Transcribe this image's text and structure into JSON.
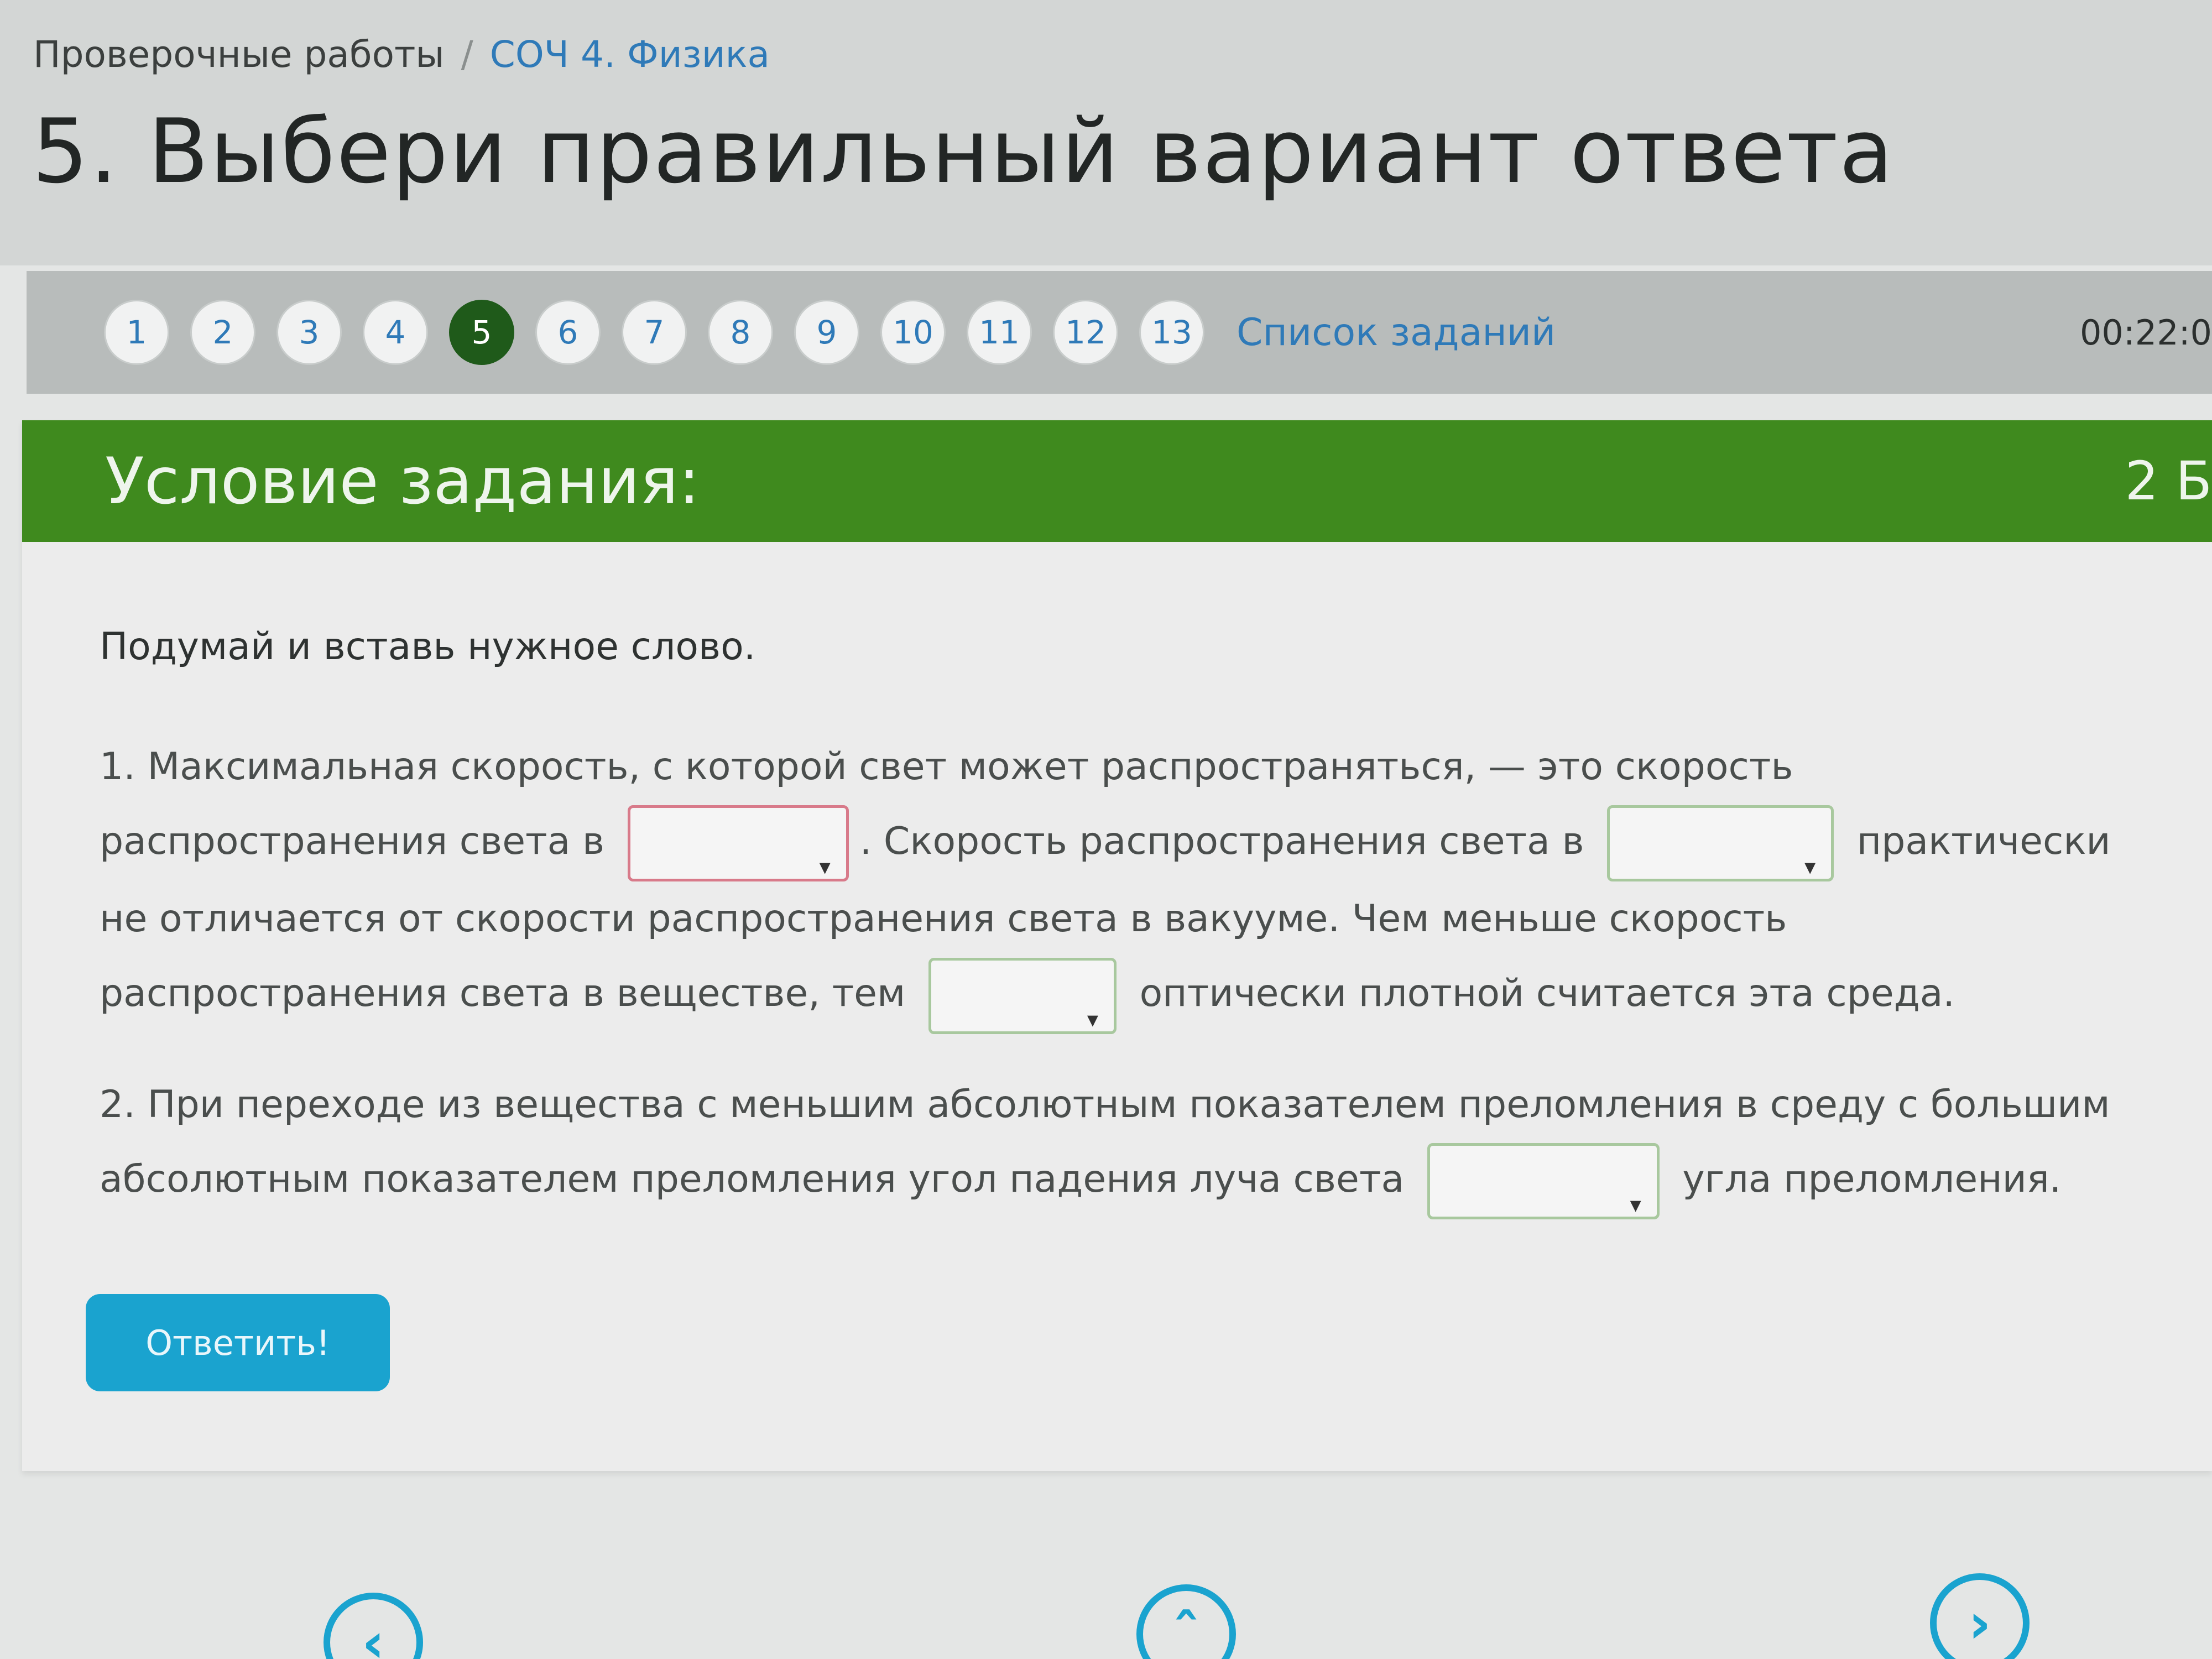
{
  "breadcrumb": {
    "root": "Проверочные работы",
    "separator": "/",
    "current": "СОЧ 4. Физика"
  },
  "page_title": "5. Выбери правильный вариант ответа",
  "pager": {
    "pages": [
      "1",
      "2",
      "3",
      "4",
      "5",
      "6",
      "7",
      "8",
      "9",
      "10",
      "11",
      "12",
      "13"
    ],
    "active": "5",
    "task_list_label": "Список заданий",
    "timer": "00:22:0"
  },
  "card": {
    "title": "Условие задания:",
    "points": "2 Б",
    "instruction": "Подумай и вставь нужное слово.",
    "q1": {
      "part1": "1. Максимальная скорость, с которой свет может распространяться, — это скорость распространения света в",
      "part2": ". Скорость распространения света в",
      "part3": "практически не отличается от скорости распространения света в вакууме. Чем меньше скорость распространения света в веществе, тем",
      "part4": "оптически плотной считается эта среда."
    },
    "q2": {
      "part1": "2.  При переходе из вещества с  меньшим абсолютным показателем преломления в среду с большим абсолютным показателем преломления угол падения луча света",
      "part2": "угла преломления."
    },
    "dropdown_arrow": "▾",
    "answer_button": "Ответить!"
  },
  "nav": {
    "prev_icon": "chevron-left-icon",
    "up_icon": "chevron-up-icon",
    "next_icon": "chevron-right-icon"
  },
  "colors": {
    "header_green": "#3f8a1e",
    "active_page": "#1f5a1a",
    "link_blue": "#2f7ab8",
    "button_cyan": "#1aa3cf"
  }
}
